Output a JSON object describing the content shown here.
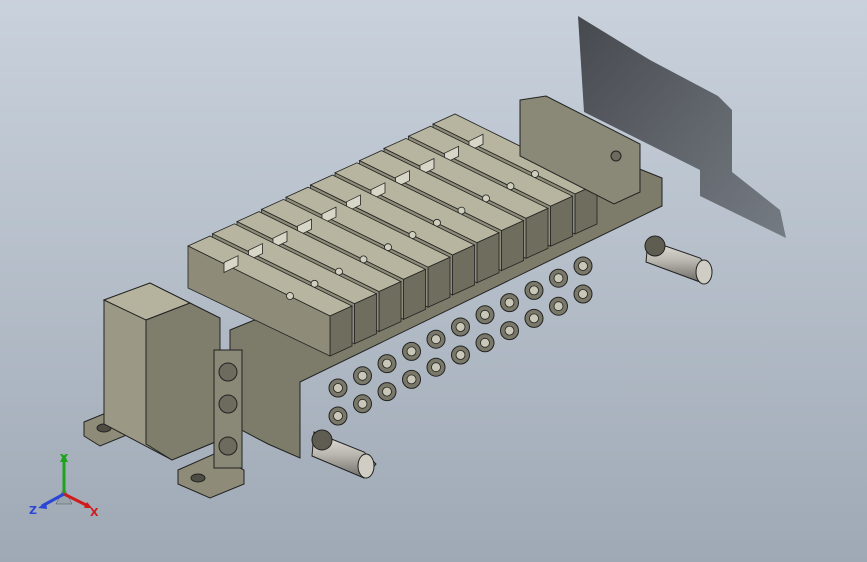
{
  "viewport": {
    "background_top": "#c9d2dc",
    "background_bottom": "#9fa9b5"
  },
  "model": {
    "kind": "pneumatic solenoid valve manifold",
    "valve_station_count": 11,
    "body_color": "#8e8c78",
    "fitting_color": "#7a7868",
    "shadow_color": "#3f4247"
  },
  "triad": {
    "x_label": "X",
    "y_label": "Y",
    "z_label": "Z",
    "x_color": "#d11a1a",
    "y_color": "#1fa21f",
    "z_color": "#2b46d6"
  }
}
